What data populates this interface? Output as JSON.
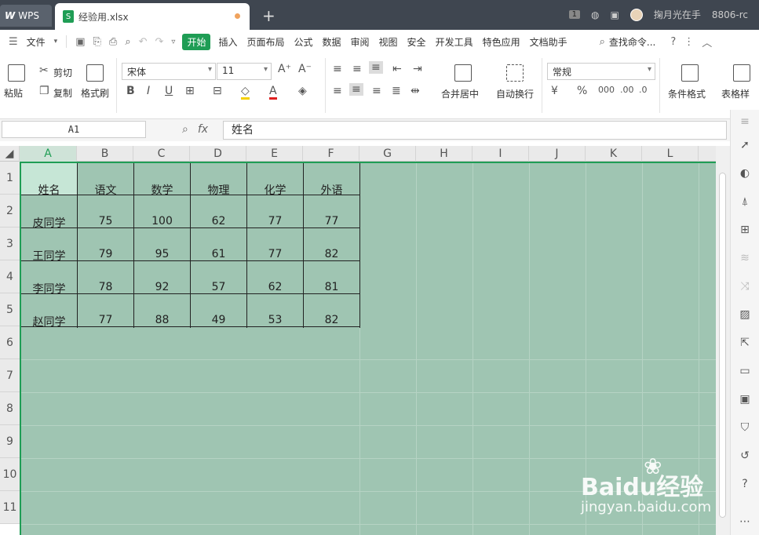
{
  "titlebar": {
    "app_tab": "WPS",
    "file_tab": "经验用.xlsx",
    "badge": "1",
    "username": "掬月光在手",
    "id_text": "8806-rc"
  },
  "menu": {
    "items": [
      "文件",
      "开始",
      "插入",
      "页面布局",
      "公式",
      "数据",
      "审阅",
      "视图",
      "安全",
      "开发工具",
      "特色应用",
      "文档助手"
    ],
    "search": "查找命令..."
  },
  "ribbon": {
    "paste": "粘贴",
    "cut": "剪切",
    "copy": "复制",
    "format_painter": "格式刷",
    "font_name": "宋体",
    "font_size": "11",
    "merge_center": "合并居中",
    "wrap_text": "自动换行",
    "number_format": "常规",
    "conditional_format": "条件格式",
    "table_style": "表格样"
  },
  "formula_bar": {
    "cell_ref": "A1",
    "fx": "fx",
    "value": "姓名"
  },
  "columns": [
    "A",
    "B",
    "C",
    "D",
    "E",
    "F",
    "G",
    "H",
    "I",
    "J",
    "K",
    "L"
  ],
  "rows": [
    "1",
    "2",
    "3",
    "4",
    "5",
    "6",
    "7",
    "8",
    "9",
    "10",
    "11"
  ],
  "table": {
    "header": [
      "姓名",
      "语文",
      "数学",
      "物理",
      "化学",
      "外语"
    ],
    "rows": [
      [
        "皮同学",
        "75",
        "100",
        "62",
        "77",
        "77"
      ],
      [
        "王同学",
        "79",
        "95",
        "61",
        "77",
        "82"
      ],
      [
        "李同学",
        "78",
        "92",
        "57",
        "62",
        "81"
      ],
      [
        "赵同学",
        "77",
        "88",
        "49",
        "53",
        "82"
      ]
    ]
  },
  "watermark": {
    "brand": "Baidu经验",
    "url": "jingyan.baidu.com"
  },
  "colors": {
    "selection": "#9fc5b2",
    "accent": "#1f9d55",
    "titlebar": "#3f4650"
  }
}
